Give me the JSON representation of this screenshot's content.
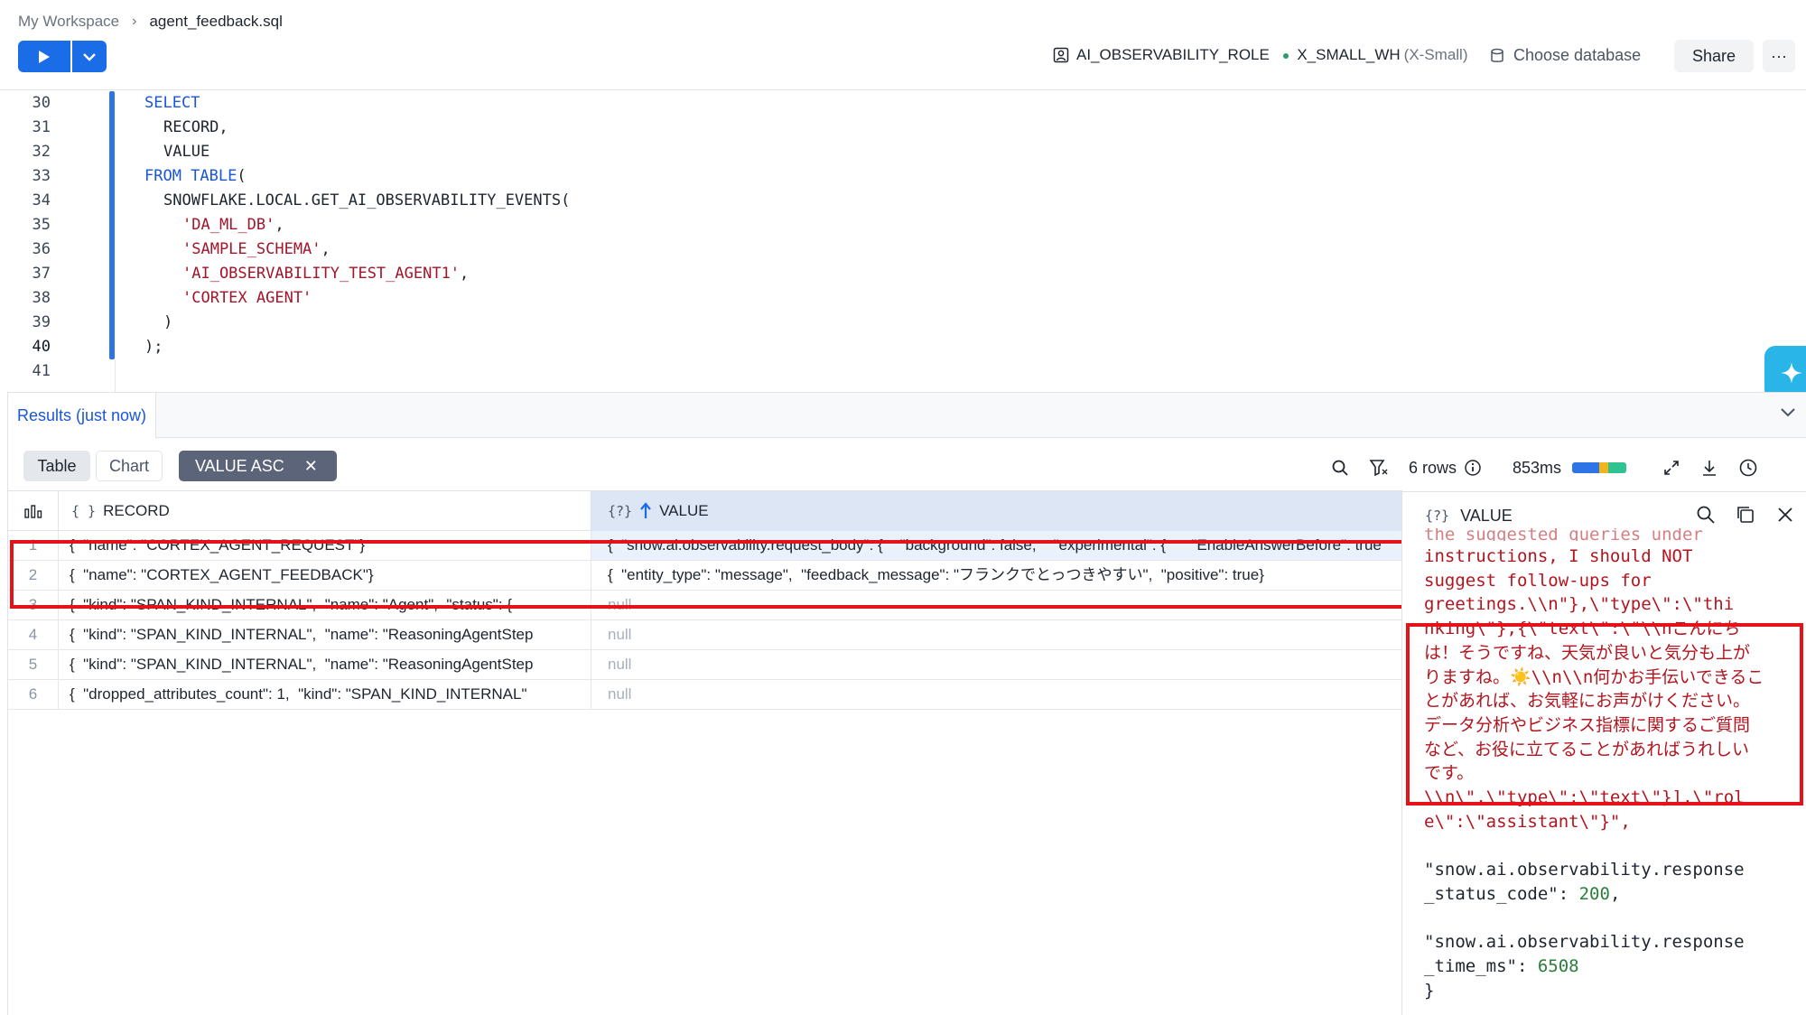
{
  "breadcrumb": {
    "workspace": "My Workspace",
    "file": "agent_feedback.sql"
  },
  "context": {
    "role": "AI_OBSERVABILITY_ROLE",
    "warehouse": "X_SMALL_WH",
    "warehouse_size": "(X-Small)"
  },
  "header": {
    "choose_db": "Choose database",
    "share": "Share",
    "more": "···"
  },
  "editor": {
    "lines": [
      {
        "n": "30",
        "parts": [
          [
            "kw",
            "SELECT"
          ]
        ],
        "indent": 0
      },
      {
        "n": "31",
        "parts": [
          [
            "txt",
            "RECORD,"
          ]
        ],
        "indent": 1
      },
      {
        "n": "32",
        "parts": [
          [
            "txt",
            "VALUE"
          ]
        ],
        "indent": 1
      },
      {
        "n": "33",
        "parts": [
          [
            "kw",
            "FROM TABLE"
          ],
          [
            "txt",
            "("
          ]
        ],
        "indent": 0
      },
      {
        "n": "34",
        "parts": [
          [
            "txt",
            "SNOWFLAKE.LOCAL.GET_AI_OBSERVABILITY_EVENTS("
          ]
        ],
        "indent": 1
      },
      {
        "n": "35",
        "parts": [
          [
            "str",
            "'DA_ML_DB'"
          ],
          [
            "txt",
            ","
          ]
        ],
        "indent": 2
      },
      {
        "n": "36",
        "parts": [
          [
            "str",
            "'SAMPLE_SCHEMA'"
          ],
          [
            "txt",
            ","
          ]
        ],
        "indent": 2
      },
      {
        "n": "37",
        "parts": [
          [
            "str",
            "'AI_OBSERVABILITY_TEST_AGENT1'"
          ],
          [
            "txt",
            ","
          ]
        ],
        "indent": 2
      },
      {
        "n": "38",
        "parts": [
          [
            "str",
            "'CORTEX AGENT'"
          ]
        ],
        "indent": 2
      },
      {
        "n": "39",
        "parts": [
          [
            "txt",
            ")"
          ]
        ],
        "indent": 1
      },
      {
        "n": "40",
        "parts": [
          [
            "txt",
            ");"
          ]
        ],
        "indent": 0,
        "active": true
      },
      {
        "n": "41",
        "parts": [],
        "indent": 0
      }
    ]
  },
  "results": {
    "tab": "Results (just now)",
    "view_table": "Table",
    "view_chart": "Chart",
    "sort_chip": "VALUE ASC",
    "rows_count": "6 rows",
    "duration": "853ms",
    "columns": {
      "record": "RECORD",
      "value": "VALUE"
    },
    "rows": [
      {
        "idx": "1",
        "record": "{  \"name\": \"CORTEX_AGENT_REQUEST\"}",
        "value": "{  \"snow.ai.observability.request_body\": {    \"background\": false,    \"experimental\": {      \"EnableAnswerBefore\": true",
        "null": false,
        "selected": true
      },
      {
        "idx": "2",
        "record": "{  \"name\": \"CORTEX_AGENT_FEEDBACK\"}",
        "value": "{  \"entity_type\": \"message\",  \"feedback_message\": \"フランクでとっつきやすい\",  \"positive\": true}",
        "null": false
      },
      {
        "idx": "3",
        "record": "{  \"kind\": \"SPAN_KIND_INTERNAL\",  \"name\": \"Agent\",  \"status\": {",
        "value": "null",
        "null": true
      },
      {
        "idx": "4",
        "record": "{  \"kind\": \"SPAN_KIND_INTERNAL\",  \"name\": \"ReasoningAgentStep",
        "value": "null",
        "null": true
      },
      {
        "idx": "5",
        "record": "{  \"kind\": \"SPAN_KIND_INTERNAL\",  \"name\": \"ReasoningAgentStep",
        "value": "null",
        "null": true
      },
      {
        "idx": "6",
        "record": "{  \"dropped_attributes_count\": 1,  \"kind\": \"SPAN_KIND_INTERNAL\"",
        "value": "null",
        "null": true
      }
    ]
  },
  "detail": {
    "title": "VALUE",
    "lines_top": [
      "instructions, I should NOT",
      "suggest follow-ups for",
      "greetings.\\\\n\"},\\\"type\\\":\\\"thi"
    ],
    "lines_boxed": [
      "nking\\\"},{\\\"text\\\":\\\"\\\\nこんにち",
      "は！そうですね、天気が良いと気分も上が",
      "りますね。☀️\\\\n\\\\n何かお手伝いできるこ",
      "とがあれば、お気軽にお声がけください。",
      "データ分析やビジネス指標に関するご質問",
      "など、お役に立てることがあればうれしい",
      "です。",
      "\\\\n\\\",\\\"type\\\":\\\"text\\\"}],\\\"rol",
      "e\\\":\\\"assistant\\\"}\","
    ],
    "k1a": "\"snow.ai.observability.response",
    "k1b": "_status_code\"",
    "v1": "200",
    "k2a": "\"snow.ai.observability.response",
    "k2b": "_time_ms\"",
    "v2": "6508",
    "close": "}"
  },
  "colors": {
    "accent": "#1a6ce7",
    "highlight": "#e5121a",
    "sort_chip": "#5b6478"
  }
}
